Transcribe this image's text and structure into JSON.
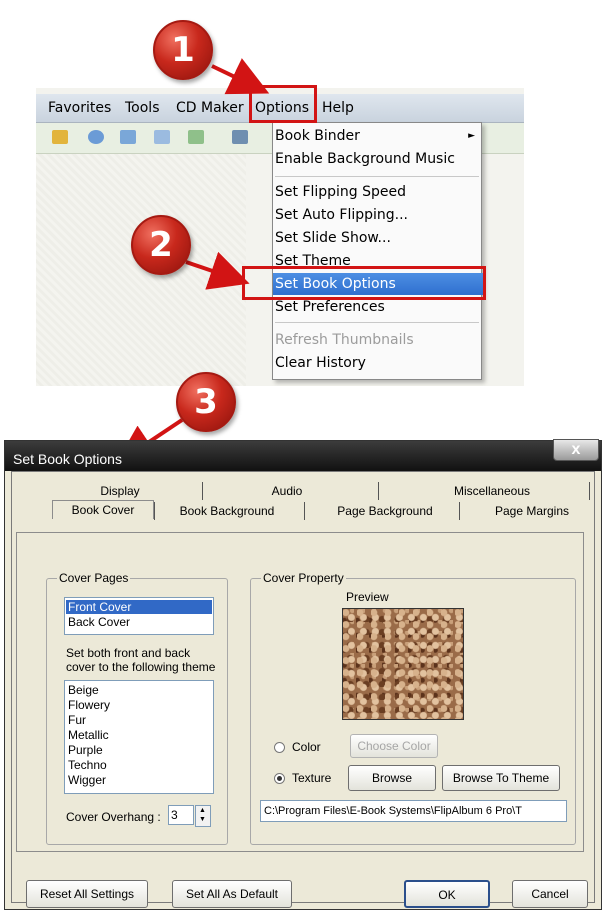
{
  "steps": [
    "1",
    "2",
    "3"
  ],
  "menubar": {
    "items": [
      "Favorites",
      "Tools",
      "CD Maker",
      "Options",
      "Help"
    ]
  },
  "options_menu": {
    "items": [
      {
        "label": "Book Binder",
        "arrow": "►"
      },
      {
        "label": "Enable Background Music"
      },
      {
        "label": "Set Flipping Speed"
      },
      {
        "label": "Set Auto Flipping..."
      },
      {
        "label": "Set Slide Show..."
      },
      {
        "label": "Set Theme"
      },
      {
        "label": "Set Book Options",
        "highlighted": true
      },
      {
        "label": "Set Preferences"
      },
      {
        "label": "Refresh Thumbnails",
        "disabled": true
      },
      {
        "label": "Clear History"
      }
    ]
  },
  "dialog": {
    "title": "Set Book Options",
    "close_label": "x",
    "tabs_back": [
      "Display",
      "Audio",
      "Miscellaneous"
    ],
    "tabs_front": [
      "Book Cover",
      "Book Background",
      "Page Background",
      "Page Margins"
    ],
    "cover_pages": {
      "label": "Cover Pages",
      "items": [
        "Front Cover",
        "Back Cover"
      ],
      "selected": "Front Cover",
      "instruction_line1": "Set both front and back",
      "instruction_line2": "cover to the following theme",
      "themes": [
        "Beige",
        "Flowery",
        "Fur",
        "Metallic",
        "Purple",
        "Techno",
        "Wigger"
      ],
      "overhang_label": "Cover Overhang :",
      "overhang_value": "3"
    },
    "cover_property": {
      "label": "Cover Property",
      "preview_label": "Preview",
      "color_label": "Color",
      "texture_label": "Texture",
      "selected": "Texture",
      "choose_color_button": "Choose Color",
      "browse_button": "Browse",
      "browse_theme_button": "Browse To Theme",
      "path": "C:\\Program Files\\E-Book Systems\\FlipAlbum 6 Pro\\T"
    },
    "buttons": {
      "reset": "Reset All Settings",
      "set_default": "Set All As Default",
      "ok": "OK",
      "cancel": "Cancel"
    }
  },
  "colors": {
    "badge_red": "#c8281c",
    "highlight_box": "#d21414",
    "menu_highlight": "#3a7bd5"
  }
}
